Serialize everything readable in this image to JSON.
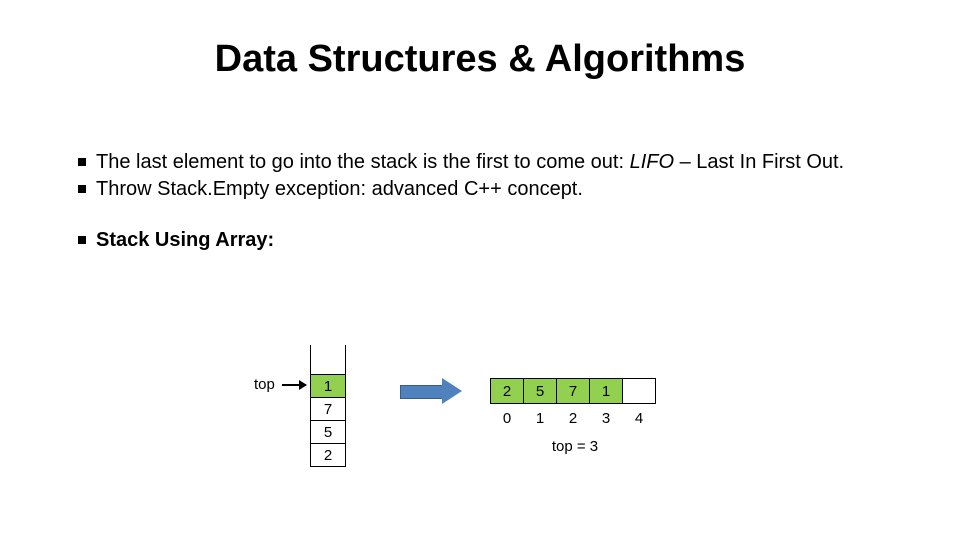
{
  "title": "Data Structures & Algorithms",
  "bullets": {
    "b1a": "The last element to go into the stack is the first to come out: ",
    "b1b": "LIFO",
    "b1c": " – Last In First Out.",
    "b2": "Throw Stack.Empty exception: advanced C++ concept.",
    "b3": "Stack Using Array:"
  },
  "vstack": [
    "1",
    "7",
    "5",
    "2"
  ],
  "toplabel": "top",
  "harray": {
    "cells": [
      "2",
      "5",
      "7",
      "1",
      ""
    ],
    "filled": [
      true,
      true,
      true,
      true,
      false
    ],
    "indices": [
      "0",
      "1",
      "2",
      "3",
      "4"
    ]
  },
  "topcaption": "top = 3",
  "colors": {
    "green": "#92d050",
    "arrow": "#4f81bd"
  }
}
